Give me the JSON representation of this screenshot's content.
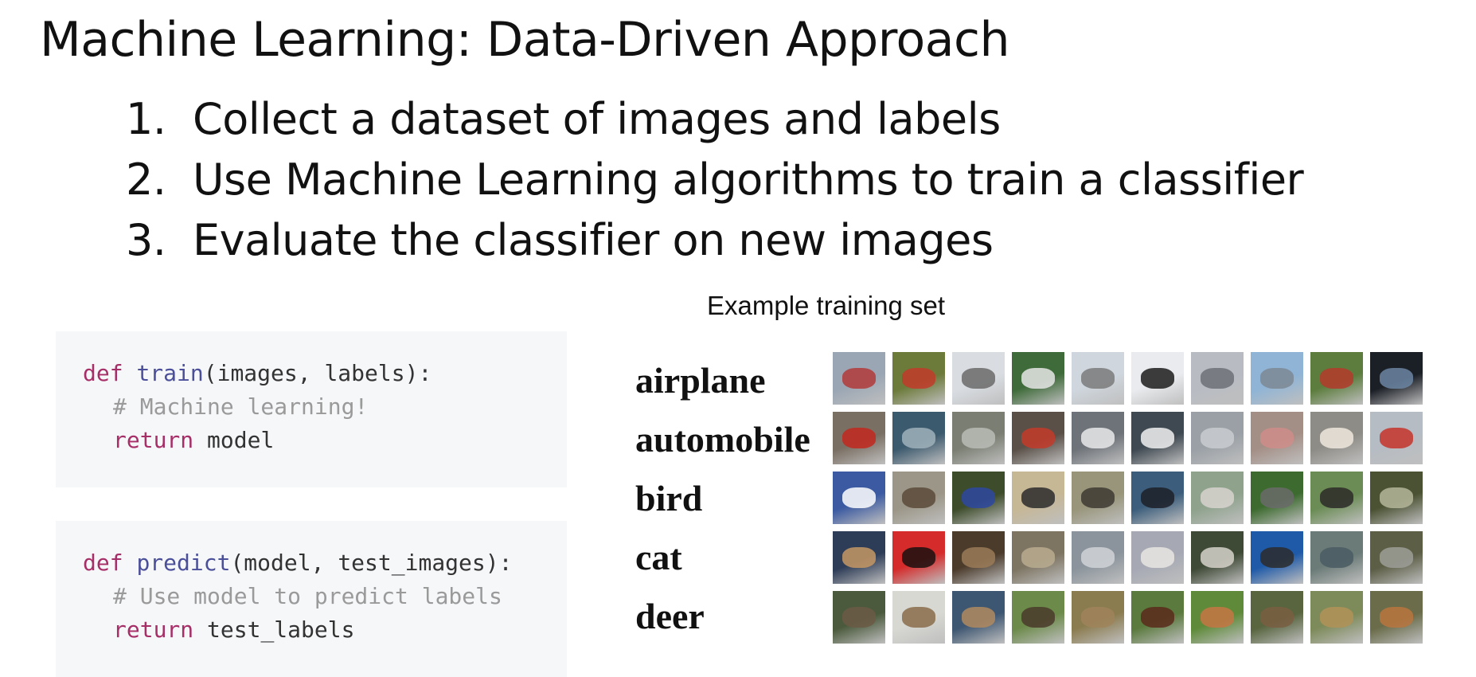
{
  "slide": {
    "title": "Machine Learning: Data-Driven Approach",
    "steps": [
      {
        "num": "1.",
        "text": "Collect a dataset of images and labels"
      },
      {
        "num": "2.",
        "text": "Use Machine Learning algorithms to train a classifier"
      },
      {
        "num": "3.",
        "text": "Evaluate the classifier on new images"
      }
    ]
  },
  "code": {
    "train": {
      "def": "def",
      "name": "train",
      "args": "(images, labels):",
      "comment": "# Machine learning!",
      "ret": "return",
      "ret_value": " model"
    },
    "predict": {
      "def": "def",
      "name": "predict",
      "args": "(model, test_images):",
      "comment": "# Use model to predict labels",
      "ret": "return",
      "ret_value": " test_labels"
    }
  },
  "training_set": {
    "caption": "Example training set",
    "classes": [
      {
        "label": "airplane",
        "thumb_colors": [
          [
            "#9aa6b4",
            "#b23a3a"
          ],
          [
            "#6c7a3a",
            "#c23b2a"
          ],
          [
            "#d9dde2",
            "#6a6a6a"
          ],
          [
            "#3f6b3a",
            "#e6e6e6"
          ],
          [
            "#cfd6dd",
            "#7a7a7a"
          ],
          [
            "#e9ebee",
            "#1c1c1c"
          ],
          [
            "#b8bcc2",
            "#6c7077"
          ],
          [
            "#8fb4d6",
            "#7d8894"
          ],
          [
            "#5d7d3e",
            "#b33a2b"
          ],
          [
            "#1b1f26",
            "#6c86a3"
          ]
        ]
      },
      {
        "label": "automobile",
        "thumb_colors": [
          [
            "#7a6f63",
            "#c2281f"
          ],
          [
            "#3c5a6e",
            "#9fb1bb"
          ],
          [
            "#7b7f73",
            "#b9bcb6"
          ],
          [
            "#5a5048",
            "#c33b2a"
          ],
          [
            "#6e7379",
            "#e9e9ea"
          ],
          [
            "#3f4952",
            "#f0f0f0"
          ],
          [
            "#9aa0a6",
            "#c9cdd1"
          ],
          [
            "#a48f86",
            "#cf8d88"
          ],
          [
            "#8e8c86",
            "#efe8de"
          ],
          [
            "#b6bcc3",
            "#c6342b"
          ]
        ]
      },
      {
        "label": "bird",
        "thumb_colors": [
          [
            "#3b5aa1",
            "#ffffff"
          ],
          [
            "#9b9687",
            "#5b4a38"
          ],
          [
            "#3d4c2a",
            "#2d48a0"
          ],
          [
            "#c6b795",
            "#2b2b2b"
          ],
          [
            "#98957a",
            "#3e3a33"
          ],
          [
            "#3c5e7c",
            "#1c2029"
          ],
          [
            "#8ea28c",
            "#d7d4cf"
          ],
          [
            "#3d6b2f",
            "#6a6b6a"
          ],
          [
            "#6b8c55",
            "#2b2a28"
          ],
          [
            "#4b5233",
            "#b5b69a"
          ]
        ]
      },
      {
        "label": "cat",
        "thumb_colors": [
          [
            "#2d3c57",
            "#c69864"
          ],
          [
            "#d52b2b",
            "#1a1010"
          ],
          [
            "#4b3b2b",
            "#9a7b57"
          ],
          [
            "#7d7462",
            "#b9ab8f"
          ],
          [
            "#8b949c",
            "#d0d4d8"
          ],
          [
            "#a6a9b4",
            "#e9e6e3"
          ],
          [
            "#3f4a36",
            "#d6d2ca"
          ],
          [
            "#1f5aa8",
            "#2b2b2b"
          ],
          [
            "#6b7b77",
            "#4a5c63"
          ],
          [
            "#5c5e46",
            "#9c9e96"
          ]
        ]
      },
      {
        "label": "deer",
        "thumb_colors": [
          [
            "#4b5a3c",
            "#6b5b45"
          ],
          [
            "#d7d8d2",
            "#8a6c4a"
          ],
          [
            "#3d5671",
            "#b08a5f"
          ],
          [
            "#6c8a4a",
            "#4a3a2a"
          ],
          [
            "#8b7c50",
            "#a0845b"
          ],
          [
            "#5b7a3e",
            "#5a2a1b"
          ],
          [
            "#5f8a3a",
            "#c67543"
          ],
          [
            "#58653f",
            "#7a5e42"
          ],
          [
            "#7d8a5a",
            "#b09257"
          ],
          [
            "#6a6c4a",
            "#b9753e"
          ]
        ]
      }
    ]
  }
}
